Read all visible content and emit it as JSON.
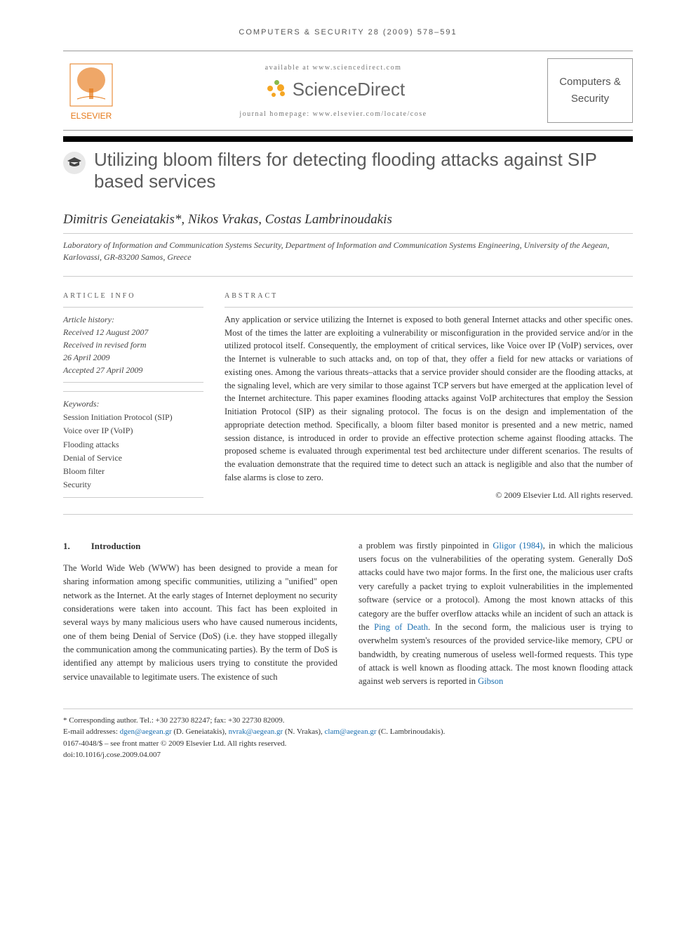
{
  "running_head": "computers & security 28 (2009) 578–591",
  "header": {
    "available": "available at www.sciencedirect.com",
    "brand": "ScienceDirect",
    "homepage": "journal homepage: www.elsevier.com/locate/cose",
    "publisher": "ELSEVIER",
    "journal": "Computers & Security"
  },
  "article": {
    "title": "Utilizing bloom filters for detecting flooding attacks against SIP based services",
    "authors": "Dimitris Geneiatakis*, Nikos Vrakas, Costas Lambrinoudakis",
    "affiliation": "Laboratory of Information and Communication Systems Security, Department of Information and Communication Systems Engineering, University of the Aegean, Karlovassi, GR-83200 Samos, Greece"
  },
  "info": {
    "heading": "ARTICLE INFO",
    "history_label": "Article history:",
    "received": "Received 12 August 2007",
    "revised1": "Received in revised form",
    "revised2": "26 April 2009",
    "accepted": "Accepted 27 April 2009",
    "keywords_label": "Keywords:",
    "keywords": [
      "Session Initiation Protocol (SIP)",
      "Voice over IP (VoIP)",
      "Flooding attacks",
      "Denial of Service",
      "Bloom filter",
      "Security"
    ]
  },
  "abstract": {
    "heading": "ABSTRACT",
    "text": "Any application or service utilizing the Internet is exposed to both general Internet attacks and other specific ones. Most of the times the latter are exploiting a vulnerability or misconfiguration in the provided service and/or in the utilized protocol itself. Consequently, the employment of critical services, like Voice over IP (VoIP) services, over the Internet is vulnerable to such attacks and, on top of that, they offer a field for new attacks or variations of existing ones. Among the various threats–attacks that a service provider should consider are the flooding attacks, at the signaling level, which are very similar to those against TCP servers but have emerged at the application level of the Internet architecture. This paper examines flooding attacks against VoIP architectures that employ the Session Initiation Protocol (SIP) as their signaling protocol. The focus is on the design and implementation of the appropriate detection method. Specifically, a bloom filter based monitor is presented and a new metric, named session distance, is introduced in order to provide an effective protection scheme against flooding attacks. The proposed scheme is evaluated through experimental test bed architecture under different scenarios. The results of the evaluation demonstrate that the required time to detect such an attack is negligible and also that the number of false alarms is close to zero.",
    "copyright": "© 2009 Elsevier Ltd. All rights reserved."
  },
  "section1": {
    "num": "1.",
    "title": "Introduction"
  },
  "body": {
    "col1": "The World Wide Web (WWW) has been designed to provide a mean for sharing information among specific communities, utilizing a \"unified\" open network as the Internet. At the early stages of Internet deployment no security considerations were taken into account. This fact has been exploited in several ways by many malicious users who have caused numerous incidents, one of them being Denial of Service (DoS) (i.e. they have stopped illegally the communication among the communicating parties). By the term of DoS is identified any attempt by malicious users trying to constitute the provided service unavailable to legitimate users. The existence of such",
    "col2a": "a problem was firstly pinpointed in ",
    "col2_ref1": "Gligor (1984)",
    "col2b": ", in which the malicious users focus on the vulnerabilities of the operating system. Generally DoS attacks could have two major forms. In the first one, the malicious user crafts very carefully a packet trying to exploit vulnerabilities in the implemented software (service or a protocol). Among the most known attacks of this category are the buffer overflow attacks while an incident of such an attack is the ",
    "col2_ref2": "Ping of Death",
    "col2c": ". In the second form, the malicious user is trying to overwhelm system's resources of the provided service-like memory, CPU or bandwidth, by creating numerous of useless well-formed requests. This type of attack is well known as flooding attack. The most known flooding attack against web servers is reported in ",
    "col2_ref3": "Gibson"
  },
  "footer": {
    "corresponding": "* Corresponding author. Tel.: +30 22730 82247; fax: +30 22730 82009.",
    "emails_label": "E-mail addresses: ",
    "email1": "dgen@aegean.gr",
    "email1_who": " (D. Geneiatakis), ",
    "email2": "nvrak@aegean.gr",
    "email2_who": " (N. Vrakas), ",
    "email3": "clam@aegean.gr",
    "email3_who": " (C. Lambrinoudakis).",
    "issn": "0167-4048/$ – see front matter © 2009 Elsevier Ltd. All rights reserved.",
    "doi": "doi:10.1016/j.cose.2009.04.007"
  }
}
